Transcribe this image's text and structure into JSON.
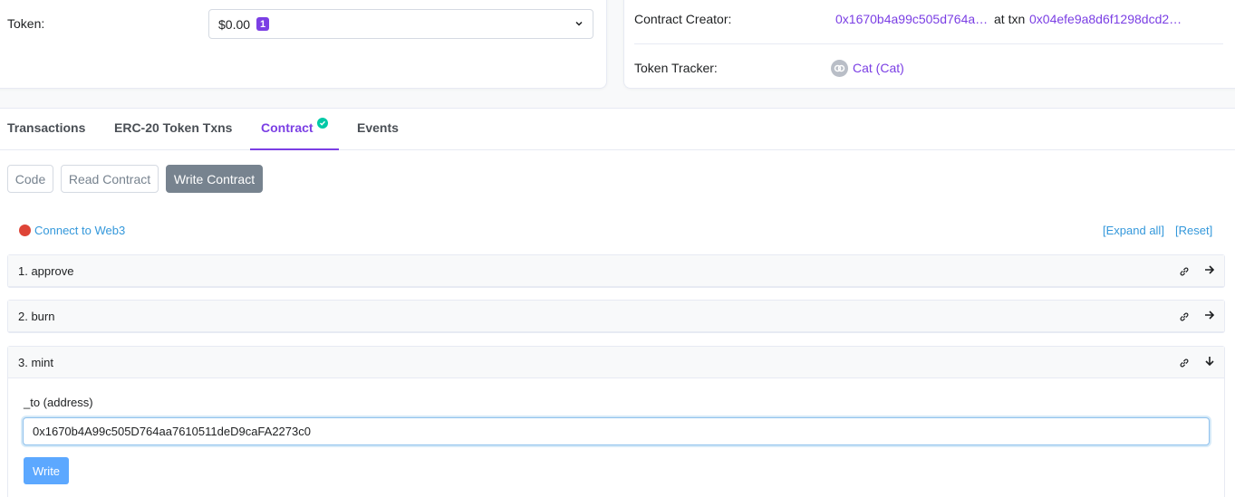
{
  "overview": {
    "token_label": "Token:",
    "token_value": "$0.00",
    "token_badge": "1",
    "contract_creator_label": "Contract Creator:",
    "contract_creator_address": "0x1670b4a99c505d764a…",
    "at_txn_label": "at txn",
    "at_txn_hash": "0x04efe9a8d6f1298dcd2…",
    "token_tracker_label": "Token Tracker:",
    "token_tracker_link": "Cat (Cat)"
  },
  "tabs": [
    {
      "label": "Transactions"
    },
    {
      "label": "ERC-20 Token Txns"
    },
    {
      "label": "Contract"
    },
    {
      "label": "Events"
    }
  ],
  "sub_buttons": {
    "code": "Code",
    "read": "Read Contract",
    "write": "Write Contract"
  },
  "web3": {
    "connect": "Connect to Web3",
    "expand_all": "[Expand all]",
    "reset": "[Reset]"
  },
  "functions": [
    {
      "label": "1. approve"
    },
    {
      "label": "2. burn"
    },
    {
      "label": "3. mint"
    }
  ],
  "mint_form": {
    "param_label": "_to (address)",
    "param_value": "0x1670b4A99c505D764aa7610511deD9caFA2273c0",
    "write_label": "Write"
  },
  "colors": {
    "accent": "#7b3fe4",
    "link": "#3498db",
    "verified": "#00c9a7",
    "disconnected": "#de4437",
    "write_button": "#5ca8ff"
  }
}
